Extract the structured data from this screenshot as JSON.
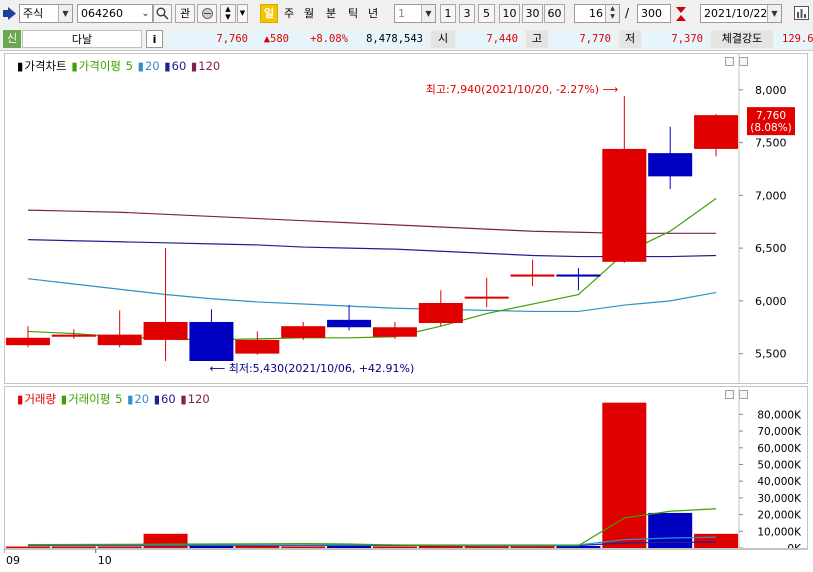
{
  "toolbar": {
    "market": "주식",
    "code": "064260",
    "gwan_label": "관",
    "periods": [
      "일",
      "주",
      "월",
      "분",
      "틱",
      "년"
    ],
    "active_period": "일",
    "unit_value": "1",
    "quick_units": [
      "1",
      "3",
      "5",
      "10",
      "30",
      "60"
    ],
    "count_value": "16",
    "count_separator": "/",
    "count_total": "300",
    "date_value": "2021/10/22"
  },
  "quote": {
    "tag": "신",
    "name": "다날",
    "info_label": "i",
    "price": "7,760",
    "change": "▲580",
    "change_pct": "+8.08%",
    "volume": "8,478,543",
    "open_label": "시",
    "open": "7,440",
    "high_label": "고",
    "high": "7,770",
    "low_label": "저",
    "low": "7,370",
    "strength_label": "체결강도",
    "strength": "129.6"
  },
  "price_legend": {
    "title": "가격차트",
    "ma_title": "가격이평",
    "ma5": "5",
    "ma20": "20",
    "ma60": "60",
    "ma120": "120"
  },
  "volume_legend": {
    "title": "거래량",
    "ma_title": "거래이평",
    "ma5": "5",
    "ma20": "20",
    "ma60": "60",
    "ma120": "120"
  },
  "annotations": {
    "high_note": "최고:7,940(2021/10/20, -2.27%)",
    "low_note": "최저:5,430(2021/10/06, +42.91%)",
    "current_price": "7,760",
    "current_pct": "(8.08%)"
  },
  "x_labels": [
    "09",
    "10"
  ],
  "colors": {
    "up": "#e00000",
    "down": "#0000c0",
    "ma5": "#40a000",
    "ma20": "#3090c8",
    "ma60": "#202090",
    "ma120": "#802050"
  },
  "chart_data": [
    {
      "type": "candlestick",
      "title": "가격차트",
      "y_ticks": [
        5500,
        6000,
        6500,
        7000,
        7500,
        8000
      ],
      "ylim": [
        5250,
        8150
      ],
      "candles": [
        {
          "open": 5580,
          "close": 5650,
          "high": 5760,
          "low": 5560
        },
        {
          "open": 5660,
          "close": 5680,
          "high": 5730,
          "low": 5640
        },
        {
          "open": 5580,
          "close": 5680,
          "high": 5910,
          "low": 5560
        },
        {
          "open": 5630,
          "close": 5800,
          "high": 6500,
          "low": 5430
        },
        {
          "open": 5800,
          "close": 5430,
          "high": 5920,
          "low": 5430
        },
        {
          "open": 5500,
          "close": 5630,
          "high": 5710,
          "low": 5490
        },
        {
          "open": 5650,
          "close": 5760,
          "high": 5800,
          "low": 5630
        },
        {
          "open": 5820,
          "close": 5750,
          "high": 5960,
          "low": 5720
        },
        {
          "open": 5660,
          "close": 5750,
          "high": 5800,
          "low": 5640
        },
        {
          "open": 5790,
          "close": 5980,
          "high": 6100,
          "low": 5760
        },
        {
          "open": 6040,
          "close": 6040,
          "high": 6220,
          "low": 5940
        },
        {
          "open": 6230,
          "close": 6250,
          "high": 6390,
          "low": 6140
        },
        {
          "open": 6250,
          "close": 6230,
          "high": 6310,
          "low": 6100
        },
        {
          "open": 6370,
          "close": 7440,
          "high": 7940,
          "low": 6360
        },
        {
          "open": 7400,
          "close": 7180,
          "high": 7650,
          "low": 7060
        },
        {
          "open": 7440,
          "close": 7760,
          "high": 7770,
          "low": 7370
        }
      ],
      "moving_averages": {
        "5": [
          5710,
          5690,
          5660,
          5640,
          5630,
          5640,
          5650,
          5650,
          5660,
          5760,
          5880,
          5970,
          6060,
          6450,
          6660,
          6970
        ],
        "20": [
          6210,
          6160,
          6110,
          6060,
          6020,
          5990,
          5970,
          5950,
          5930,
          5920,
          5910,
          5900,
          5900,
          5960,
          6000,
          6080
        ],
        "60": [
          6580,
          6570,
          6560,
          6550,
          6540,
          6530,
          6510,
          6500,
          6490,
          6470,
          6450,
          6430,
          6420,
          6420,
          6420,
          6430
        ],
        "120": [
          6860,
          6850,
          6840,
          6820,
          6800,
          6780,
          6760,
          6740,
          6720,
          6700,
          6680,
          6660,
          6650,
          6640,
          6640,
          6640
        ]
      }
    },
    {
      "type": "bar",
      "title": "거래량",
      "y_ticks": [
        "0K",
        "10,000K",
        "20,000K",
        "30,000K",
        "40,000K",
        "50,000K",
        "60,000K",
        "70,000K",
        "80,000K"
      ],
      "ylim": [
        0,
        88000
      ],
      "values_k": [
        300,
        500,
        400,
        8500,
        2500,
        1200,
        800,
        1200,
        800,
        1500,
        1600,
        1500,
        1200,
        87000,
        21000,
        8478
      ],
      "direction": [
        "up",
        "up",
        "up",
        "up",
        "down",
        "up",
        "up",
        "down",
        "up",
        "up",
        "up",
        "up",
        "down",
        "up",
        "down",
        "up"
      ],
      "moving_averages": {
        "5": [
          2000,
          2100,
          2200,
          2300,
          2400,
          2500,
          2600,
          2400,
          1800,
          1500,
          1300,
          1300,
          1400,
          18000,
          22000,
          23500
        ],
        "20": [
          1800,
          1800,
          1800,
          1800,
          1800,
          1800,
          1800,
          1800,
          1800,
          1800,
          1800,
          1800,
          1800,
          5000,
          6000,
          6500
        ],
        "60": [
          1500,
          1500,
          1500,
          1500,
          1500,
          1500,
          1500,
          1500,
          1500,
          1500,
          1500,
          1500,
          1500,
          3000,
          3400,
          3600
        ]
      }
    }
  ]
}
